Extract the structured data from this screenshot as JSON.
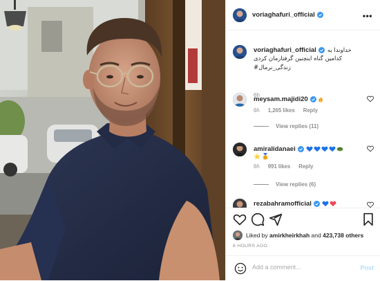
{
  "post": {
    "owner_username": "voriaghafuri_official",
    "more_icon": "more-dots-icon",
    "caption": {
      "line1": "خداوندا به",
      "line2": "کدامین گناه اینچنین گرفتارمان کردی",
      "line3": "زندگی_نرمال#",
      "time": "6h"
    },
    "comments": [
      {
        "username": "meysam.majidi20",
        "emoji": "fire-emoji",
        "time": "6h",
        "likes": "1,265 likes",
        "reply_label": "Reply",
        "view_replies": "View replies (11)"
      },
      {
        "username": "amiralidanaei",
        "emoji": "blue-hearts-medal-emoji",
        "time": "6h",
        "likes": "991 likes",
        "reply_label": "Reply",
        "view_replies": "View replies (6)"
      },
      {
        "username": "rezabahramofficial",
        "emoji": "blue-red-hearts-emoji"
      }
    ],
    "actions": {
      "icons": [
        "heart-icon",
        "comment-icon",
        "share-icon",
        "bookmark-icon"
      ]
    },
    "likes": {
      "prefix": "Liked by",
      "user": "amirkheirkhah",
      "and": "and",
      "count": "423,738 others"
    },
    "timestamp": "6 HOURS AGO",
    "add_comment": {
      "placeholder": "Add a comment...",
      "post_label": "Post"
    }
  },
  "colors": {
    "verified": "#3897f0",
    "meta_gray": "#8e8e8e",
    "post_disabled": "#b2dffc",
    "heart_blue": "#1d73e8",
    "heart_red": "#ed4956"
  }
}
